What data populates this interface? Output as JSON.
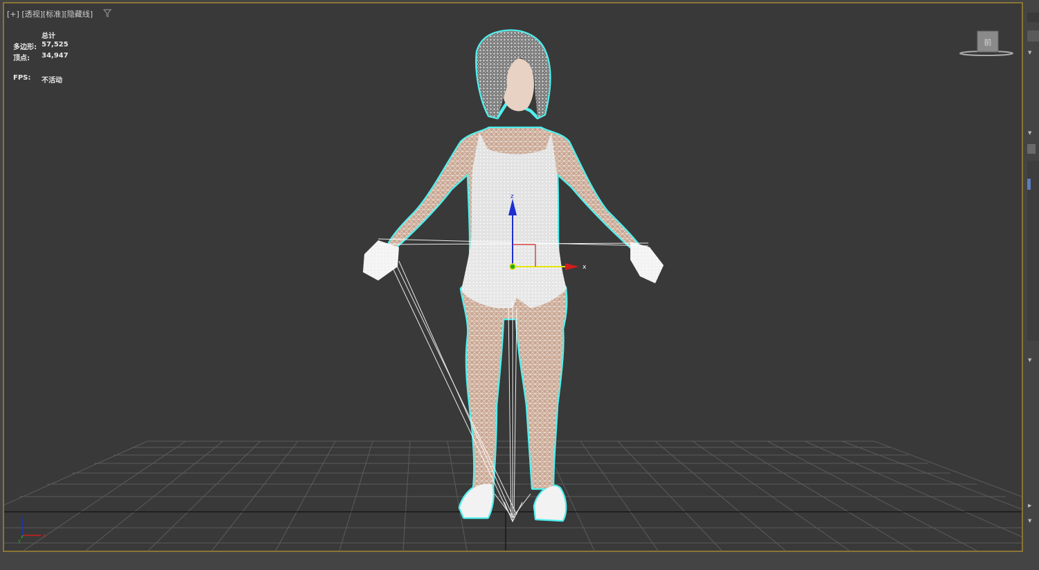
{
  "viewport": {
    "label_parts": [
      "[+]",
      "[透视]",
      "[标准]",
      "[隐藏线]"
    ],
    "stats": {
      "header": "总计",
      "polygons_label": "多边形:",
      "polygons_value": "57,525",
      "vertices_label": "顶点:",
      "vertices_value": "34,947",
      "fps_label": "FPS:",
      "fps_value": "不活动"
    },
    "viewcube_label": "前",
    "gizmo_axes": {
      "x": "x",
      "z": "z"
    },
    "corner_axes": {
      "z": "z",
      "x": "x",
      "y": "y"
    }
  },
  "colors": {
    "viewport_bg": "#393939",
    "active_border": "#8b7535",
    "selection_outline": "#4ff0ee",
    "wire": "#ffffff",
    "skin_fill": "#c8a590",
    "axis_x": "#d11c1c",
    "axis_y": "#e6e60a",
    "axis_z": "#1c2fd1"
  },
  "icons": [
    "filter-icon",
    "viewcube-icon",
    "move-gizmo-icon",
    "axis-tripod-icon"
  ]
}
